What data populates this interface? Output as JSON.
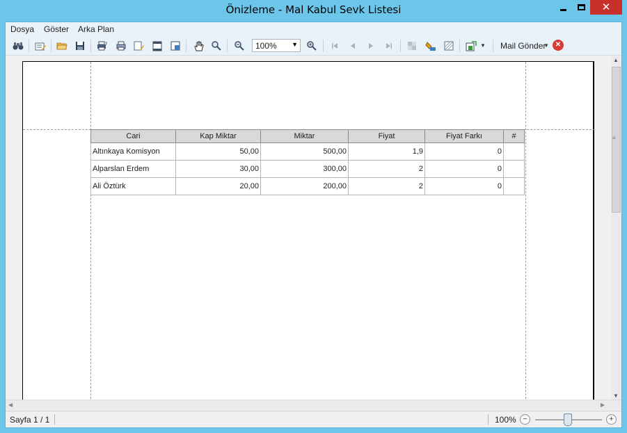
{
  "window": {
    "title": "Önizleme - Mal Kabul Sevk Listesi",
    "close_glyph": "✕"
  },
  "menu": {
    "items": [
      {
        "label": "Dosya"
      },
      {
        "label": "Göster"
      },
      {
        "label": "Arka Plan"
      }
    ]
  },
  "toolbar": {
    "zoom_value": "100%",
    "mail_label": "Mail Gönder",
    "icons": {
      "search": "binoculars-icon",
      "customize": "document-edit-icon",
      "open": "folder-open-icon",
      "save": "floppy-disk-icon",
      "print_dialog": "print-dialog-icon",
      "quick_print": "printer-icon",
      "page_setup": "page-setup-icon",
      "header_footer": "header-footer-icon",
      "scale": "scale-icon",
      "hand": "hand-tool-icon",
      "magnifier": "magnifier-icon",
      "zoom_out": "zoom-out-icon",
      "zoom_in": "zoom-in-icon",
      "first_page": "first-page-icon",
      "prev_page": "previous-page-icon",
      "next_page": "next-page-icon",
      "last_page": "last-page-icon",
      "multi_page": "multiple-pages-icon",
      "page_color": "page-color-icon",
      "watermark": "watermark-icon",
      "export": "export-icon",
      "close_preview": "close-preview-icon"
    },
    "colors": {
      "close_red": "#d83a34"
    }
  },
  "report": {
    "columns": [
      "Cari",
      "Kap Miktar",
      "Miktar",
      "Fiyat",
      "Fiyat Farkı",
      "#"
    ],
    "rows": [
      {
        "cari": "Altınkaya Komisyon",
        "kap_miktar": "50,00",
        "miktar": "500,00",
        "fiyat": "1,9",
        "fiyat_farki": "0",
        "hash": ""
      },
      {
        "cari": "Alparslan Erdem",
        "kap_miktar": "30,00",
        "miktar": "300,00",
        "fiyat": "2",
        "fiyat_farki": "0",
        "hash": ""
      },
      {
        "cari": "Ali Öztürk",
        "kap_miktar": "20,00",
        "miktar": "200,00",
        "fiyat": "2",
        "fiyat_farki": "0",
        "hash": ""
      }
    ]
  },
  "status": {
    "page_info": "Sayfa 1 / 1",
    "zoom_percent": "100%",
    "zoom_minus": "−",
    "zoom_plus": "+",
    "zoom_level": 100
  },
  "scroll": {
    "up": "▲",
    "down": "▼",
    "left": "◀",
    "right": "▶",
    "grip": "≡"
  },
  "theme": {
    "title_bar": "#6cc6ea",
    "close_button": "#c7312a",
    "header_fill": "#d9d9d9"
  }
}
